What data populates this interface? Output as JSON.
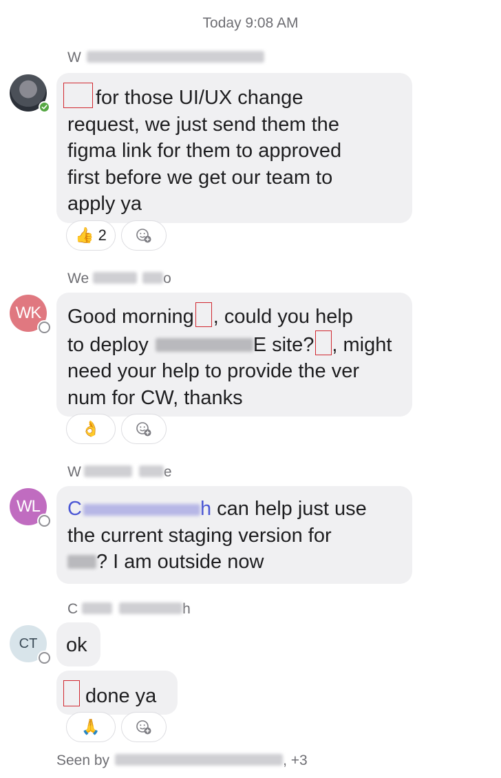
{
  "timestamp": "Today 9:08 AM",
  "icons": {
    "avatar_status_online": "check-icon",
    "add_reaction": "smiley-plus-icon"
  },
  "messages": [
    {
      "sender": "W",
      "avatar": "",
      "lines": [
        "for those UI/UX change",
        "request, we just send them the",
        "figma link for them to approved",
        "first before we get our team to",
        "apply ya"
      ],
      "reactions": [
        {
          "emoji": "👍",
          "count": "2"
        }
      ]
    },
    {
      "sender_start": "We",
      "sender_end": "o",
      "avatar": "WK",
      "line1_a": "Good morning",
      "line1_b": ", could you help",
      "line2_a": "to deploy",
      "line2_b": "E site?",
      "line2_c": ", might",
      "line3": "need your help to provide the ver",
      "line4": "num for CW, thanks",
      "reactions": [
        {
          "emoji": "👌",
          "count": ""
        }
      ]
    },
    {
      "sender_start": "W",
      "sender_end": "e",
      "avatar": "WL",
      "mention_start": "C",
      "mention_end": "h",
      "line1_b": " can help just use",
      "line2": "the current staging version for",
      "line3_b": "? I am outside now"
    },
    {
      "sender_start": "C",
      "sender_end": "h",
      "avatar": "CT",
      "bubble1": "ok",
      "bubble2": " done ya",
      "reactions": [
        {
          "emoji": "🙏",
          "count": ""
        }
      ]
    }
  ],
  "seen": {
    "prefix": "Seen by",
    "suffix": ", +3"
  }
}
